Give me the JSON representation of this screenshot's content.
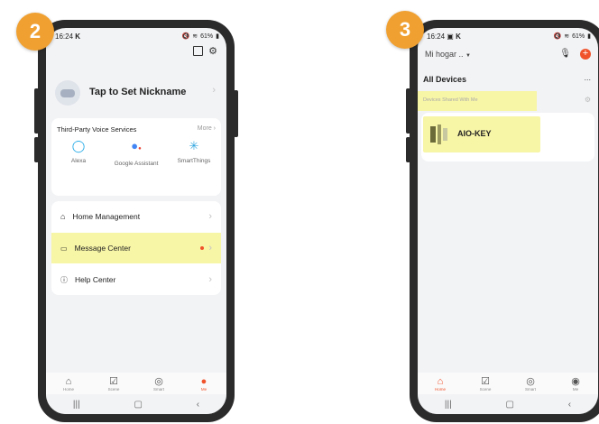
{
  "left": {
    "step": "2",
    "status": {
      "time": "16:24",
      "time_icon": "k-icon",
      "battery": "61%"
    },
    "profile": {
      "nickname": "Tap to Set Nickname"
    },
    "voice": {
      "title": "Third-Party Voice Services",
      "more": "More",
      "items": [
        {
          "label": "Alexa"
        },
        {
          "label": "Google Assistant"
        },
        {
          "label": "SmartThings"
        }
      ]
    },
    "menu": {
      "home_management": "Home Management",
      "message_center": "Message Center",
      "help_center": "Help Center"
    },
    "tabs": [
      "Home",
      "Scene",
      "Smart",
      "Me"
    ]
  },
  "right": {
    "step": "3",
    "status": {
      "time": "16:24",
      "battery": "61%"
    },
    "home_selector": "Mi hogar ..",
    "section_title": "All Devices",
    "more": "...",
    "shared_label": "Devices Shared With Me",
    "device_name": "AIO-KEY",
    "tabs": [
      "Home",
      "Scene",
      "Smart",
      "Me"
    ]
  },
  "colors": {
    "badge": "#f0a030",
    "accent": "#f0522b",
    "highlight": "#f7f5a6"
  }
}
